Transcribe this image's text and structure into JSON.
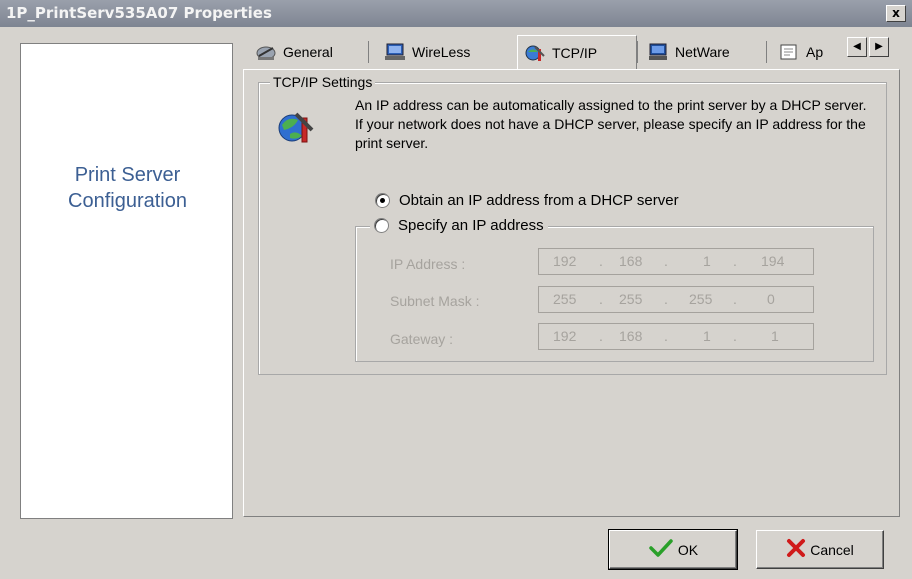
{
  "window": {
    "title": "1P_PrintServ535A07 Properties",
    "close_label": "x"
  },
  "left_panel": {
    "text": "Print Server\nConfiguration"
  },
  "tabs": [
    {
      "label": "General",
      "icon": "general-icon"
    },
    {
      "label": "WireLess",
      "icon": "wireless-icon"
    },
    {
      "label": "TCP/IP",
      "icon": "tcpip-icon",
      "active": true
    },
    {
      "label": "NetWare",
      "icon": "netware-icon"
    },
    {
      "label": "Ap",
      "icon": "app-icon"
    }
  ],
  "tab_scroll": {
    "left": "◀",
    "right": "▶"
  },
  "settings": {
    "group_title": "TCP/IP Settings",
    "info": "An IP address can be automatically assigned to the print server by a DHCP server. If your network does not have a DHCP server, please specify an IP address for the print server.",
    "radio_dhcp": "Obtain an IP address from a DHCP server",
    "radio_static": "Specify an IP address",
    "selected": "dhcp"
  },
  "fields": {
    "ip": {
      "label": "IP Address :",
      "octets": [
        "192",
        "168",
        "1",
        "194"
      ]
    },
    "subnet": {
      "label": "Subnet Mask :",
      "octets": [
        "255",
        "255",
        "255",
        "0"
      ]
    },
    "gateway": {
      "label": "Gateway :",
      "octets": [
        "192",
        "168",
        "1",
        "1"
      ]
    }
  },
  "buttons": {
    "ok": "OK",
    "cancel": "Cancel"
  },
  "colors": {
    "brand_text": "#3c5f93",
    "disabled_text": "#a6a39e",
    "ok_check": "#2aa02a",
    "cancel_x": "#d01a1a"
  }
}
